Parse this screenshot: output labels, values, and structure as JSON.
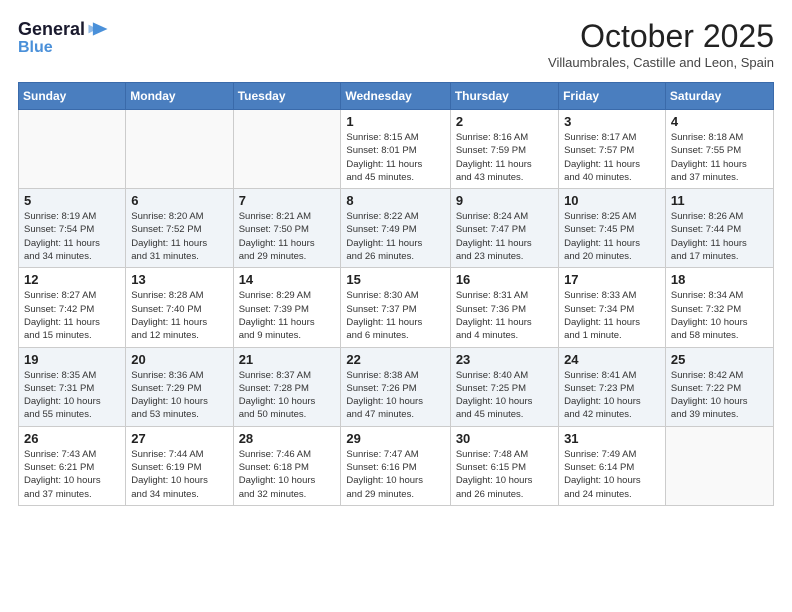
{
  "header": {
    "logo_line1": "General",
    "logo_line2": "Blue",
    "month": "October 2025",
    "location": "Villaumbrales, Castille and Leon, Spain"
  },
  "weekdays": [
    "Sunday",
    "Monday",
    "Tuesday",
    "Wednesday",
    "Thursday",
    "Friday",
    "Saturday"
  ],
  "weeks": [
    [
      {
        "day": "",
        "info": ""
      },
      {
        "day": "",
        "info": ""
      },
      {
        "day": "",
        "info": ""
      },
      {
        "day": "1",
        "info": "Sunrise: 8:15 AM\nSunset: 8:01 PM\nDaylight: 11 hours\nand 45 minutes."
      },
      {
        "day": "2",
        "info": "Sunrise: 8:16 AM\nSunset: 7:59 PM\nDaylight: 11 hours\nand 43 minutes."
      },
      {
        "day": "3",
        "info": "Sunrise: 8:17 AM\nSunset: 7:57 PM\nDaylight: 11 hours\nand 40 minutes."
      },
      {
        "day": "4",
        "info": "Sunrise: 8:18 AM\nSunset: 7:55 PM\nDaylight: 11 hours\nand 37 minutes."
      }
    ],
    [
      {
        "day": "5",
        "info": "Sunrise: 8:19 AM\nSunset: 7:54 PM\nDaylight: 11 hours\nand 34 minutes."
      },
      {
        "day": "6",
        "info": "Sunrise: 8:20 AM\nSunset: 7:52 PM\nDaylight: 11 hours\nand 31 minutes."
      },
      {
        "day": "7",
        "info": "Sunrise: 8:21 AM\nSunset: 7:50 PM\nDaylight: 11 hours\nand 29 minutes."
      },
      {
        "day": "8",
        "info": "Sunrise: 8:22 AM\nSunset: 7:49 PM\nDaylight: 11 hours\nand 26 minutes."
      },
      {
        "day": "9",
        "info": "Sunrise: 8:24 AM\nSunset: 7:47 PM\nDaylight: 11 hours\nand 23 minutes."
      },
      {
        "day": "10",
        "info": "Sunrise: 8:25 AM\nSunset: 7:45 PM\nDaylight: 11 hours\nand 20 minutes."
      },
      {
        "day": "11",
        "info": "Sunrise: 8:26 AM\nSunset: 7:44 PM\nDaylight: 11 hours\nand 17 minutes."
      }
    ],
    [
      {
        "day": "12",
        "info": "Sunrise: 8:27 AM\nSunset: 7:42 PM\nDaylight: 11 hours\nand 15 minutes."
      },
      {
        "day": "13",
        "info": "Sunrise: 8:28 AM\nSunset: 7:40 PM\nDaylight: 11 hours\nand 12 minutes."
      },
      {
        "day": "14",
        "info": "Sunrise: 8:29 AM\nSunset: 7:39 PM\nDaylight: 11 hours\nand 9 minutes."
      },
      {
        "day": "15",
        "info": "Sunrise: 8:30 AM\nSunset: 7:37 PM\nDaylight: 11 hours\nand 6 minutes."
      },
      {
        "day": "16",
        "info": "Sunrise: 8:31 AM\nSunset: 7:36 PM\nDaylight: 11 hours\nand 4 minutes."
      },
      {
        "day": "17",
        "info": "Sunrise: 8:33 AM\nSunset: 7:34 PM\nDaylight: 11 hours\nand 1 minute."
      },
      {
        "day": "18",
        "info": "Sunrise: 8:34 AM\nSunset: 7:32 PM\nDaylight: 10 hours\nand 58 minutes."
      }
    ],
    [
      {
        "day": "19",
        "info": "Sunrise: 8:35 AM\nSunset: 7:31 PM\nDaylight: 10 hours\nand 55 minutes."
      },
      {
        "day": "20",
        "info": "Sunrise: 8:36 AM\nSunset: 7:29 PM\nDaylight: 10 hours\nand 53 minutes."
      },
      {
        "day": "21",
        "info": "Sunrise: 8:37 AM\nSunset: 7:28 PM\nDaylight: 10 hours\nand 50 minutes."
      },
      {
        "day": "22",
        "info": "Sunrise: 8:38 AM\nSunset: 7:26 PM\nDaylight: 10 hours\nand 47 minutes."
      },
      {
        "day": "23",
        "info": "Sunrise: 8:40 AM\nSunset: 7:25 PM\nDaylight: 10 hours\nand 45 minutes."
      },
      {
        "day": "24",
        "info": "Sunrise: 8:41 AM\nSunset: 7:23 PM\nDaylight: 10 hours\nand 42 minutes."
      },
      {
        "day": "25",
        "info": "Sunrise: 8:42 AM\nSunset: 7:22 PM\nDaylight: 10 hours\nand 39 minutes."
      }
    ],
    [
      {
        "day": "26",
        "info": "Sunrise: 7:43 AM\nSunset: 6:21 PM\nDaylight: 10 hours\nand 37 minutes."
      },
      {
        "day": "27",
        "info": "Sunrise: 7:44 AM\nSunset: 6:19 PM\nDaylight: 10 hours\nand 34 minutes."
      },
      {
        "day": "28",
        "info": "Sunrise: 7:46 AM\nSunset: 6:18 PM\nDaylight: 10 hours\nand 32 minutes."
      },
      {
        "day": "29",
        "info": "Sunrise: 7:47 AM\nSunset: 6:16 PM\nDaylight: 10 hours\nand 29 minutes."
      },
      {
        "day": "30",
        "info": "Sunrise: 7:48 AM\nSunset: 6:15 PM\nDaylight: 10 hours\nand 26 minutes."
      },
      {
        "day": "31",
        "info": "Sunrise: 7:49 AM\nSunset: 6:14 PM\nDaylight: 10 hours\nand 24 minutes."
      },
      {
        "day": "",
        "info": ""
      }
    ]
  ]
}
